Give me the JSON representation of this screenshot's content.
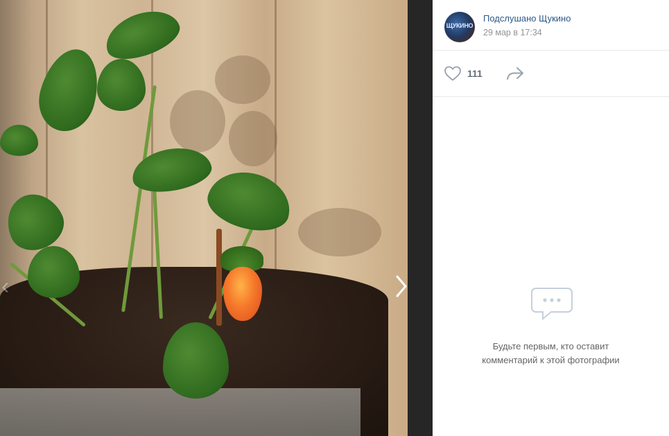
{
  "post": {
    "author": "Подслушано Щукино",
    "avatar_text": "ЩУКИНО",
    "date": "29 мар в 17:34"
  },
  "actions": {
    "likes_count": "111"
  },
  "comments": {
    "empty_line1": "Будьте первым, кто оставит",
    "empty_line2": "комментарий к этой фотографии"
  },
  "colors": {
    "link": "#2a5885",
    "muted": "#939393",
    "icon": "#b0b8c2"
  }
}
